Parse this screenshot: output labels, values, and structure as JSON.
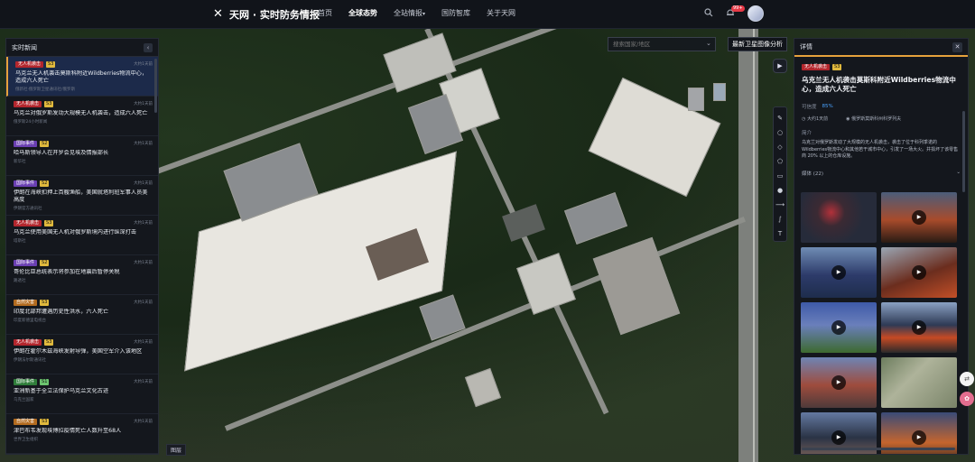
{
  "app": {
    "logo_text": "天网 · 实时防务情报"
  },
  "nav": [
    "首页",
    "全球态势",
    "全站情报",
    "国防智库",
    "关于天网"
  ],
  "nav_caret": "▾",
  "notifications": {
    "badge": "99+"
  },
  "left_panel": {
    "title": "实时新闻",
    "items": [
      {
        "tag": "无人机袭击",
        "tag_color": "red",
        "score": "S3",
        "time": "大约1天前",
        "title": "乌克兰无人机袭击莫斯科附近Wildberries物流中心，造成六人死亡",
        "source": "俄新社·俄罗斯卫星通讯社/俄罗斯"
      },
      {
        "tag": "无人机袭击",
        "tag_color": "red",
        "score": "S3",
        "time": "大约1天前",
        "title": "乌克兰对俄罗斯发动大规模无人机袭击，造成六人死亡",
        "source": "俄罗斯24小时新闻"
      },
      {
        "tag": "国际事件",
        "tag_color": "purple",
        "score": "S2",
        "time": "大约1天前",
        "title": "哈马斯领导人在开罗会见埃及情报部长",
        "source": "新华社"
      },
      {
        "tag": "国际事件",
        "tag_color": "purple",
        "score": "S2",
        "time": "大约1天前",
        "title": "伊朗在海峡扣押上百艘渔船，美国就塔利班军事人员美高度",
        "source": "伊朗官方通讯社"
      },
      {
        "tag": "无人机袭击",
        "tag_color": "red",
        "score": "S3",
        "time": "大约1天前",
        "title": "乌克兰使用美国无人机对俄罗斯境内进行纵深打击",
        "source": "塔斯社"
      },
      {
        "tag": "国际事件",
        "tag_color": "purple",
        "score": "S2",
        "time": "大约1天前",
        "title": "哥伦比亚总统表示将参加在地震后暂停关税",
        "source": "路透社"
      },
      {
        "tag": "自然灾害",
        "tag_color": "orange",
        "score": "S3",
        "time": "大约1天前",
        "title": "印度北部邦遭遇历史性洪水，六人死亡",
        "source": "印度新德里电视台"
      },
      {
        "tag": "无人机袭击",
        "tag_color": "red",
        "score": "S3",
        "time": "大约1天前",
        "title": "伊朗在霍尔木兹海峡发射导弹，美国空军介入该地区",
        "source": "伊朗法尔斯通讯社"
      },
      {
        "tag": "国际事件",
        "tag_color": "green",
        "score": "S1",
        "time": "大约1天前",
        "title": "亚洲新基于全立法保护乌克兰文化古迹",
        "source": "乌克兰国家"
      },
      {
        "tag": "自然灾害",
        "tag_color": "orange",
        "score": "S3",
        "time": "大约1天前",
        "title": "津巴布韦发现埃博拉疫情死亡人数升至68人",
        "source": "世界卫生组织"
      }
    ]
  },
  "legend_button": "图层",
  "search": {
    "placeholder": "搜索国家/地区"
  },
  "satellite_button": "最新卫星图像分析",
  "play_icon": "▶",
  "tools": [
    "✎",
    "○",
    "◇",
    "⬠",
    "▭",
    "●",
    "⟶",
    "∫",
    "T"
  ],
  "right_panel": {
    "title": "详情",
    "tag": "无人机袭击",
    "score": "S3",
    "headline": "乌克兰无人机袭击莫斯科附近Wildberries物流中心，造成六人死亡",
    "credibility_label": "可信度",
    "credibility_value": "85%",
    "time": "大约1天前",
    "location": "俄罗斯莫斯科州科罗列夫",
    "summary_label": "简介",
    "summary": "乌克兰对俄罗斯发动了大规模的无人机袭击，袭击了位于科列季诺的Wildberries物流中心和其他若干城市中心，引发了一场大火。并损坏了该零售商 20% 以上的仓库设施。",
    "media_label": "媒体 (22)",
    "media_chevron": "⌄"
  },
  "icons": {
    "search": "search-icon",
    "bell": "bell-icon",
    "close": "close-icon",
    "collapse": "chevron-left-icon"
  }
}
